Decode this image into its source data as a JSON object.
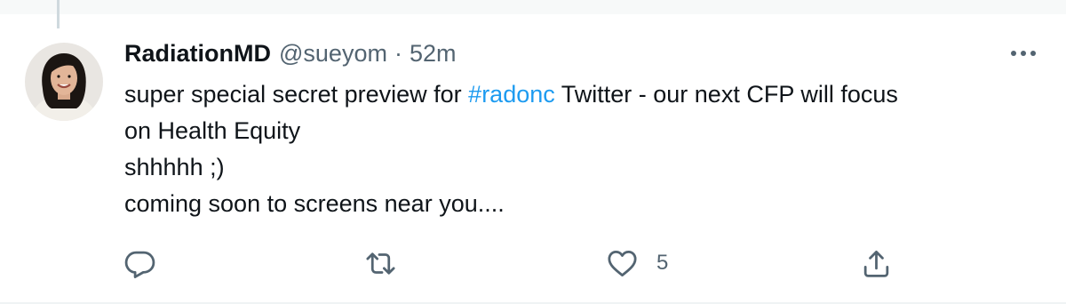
{
  "tweet": {
    "display_name": "RadiationMD",
    "handle": "@sueyom",
    "separator": "·",
    "time": "52m",
    "text": {
      "line1_before": "super special secret preview for ",
      "hashtag": "#radonc",
      "line1_after": " Twitter - our next CFP will focus",
      "line2": "on Health Equity",
      "line3": "shhhhh ;)",
      "line4": "coming soon to screens near you...."
    }
  },
  "actions": {
    "reply": {
      "icon": "reply-icon",
      "count": ""
    },
    "retweet": {
      "icon": "retweet-icon",
      "count": ""
    },
    "like": {
      "icon": "heart-icon",
      "count": "5"
    },
    "share": {
      "icon": "share-icon"
    }
  },
  "icons": {
    "more": "more-dots-icon",
    "avatar": "avatar-image"
  },
  "colors": {
    "text": "#0f1419",
    "secondary": "#536471",
    "link": "#1d9bf0",
    "background": "#ffffff",
    "thread_line": "#cfd9de"
  }
}
